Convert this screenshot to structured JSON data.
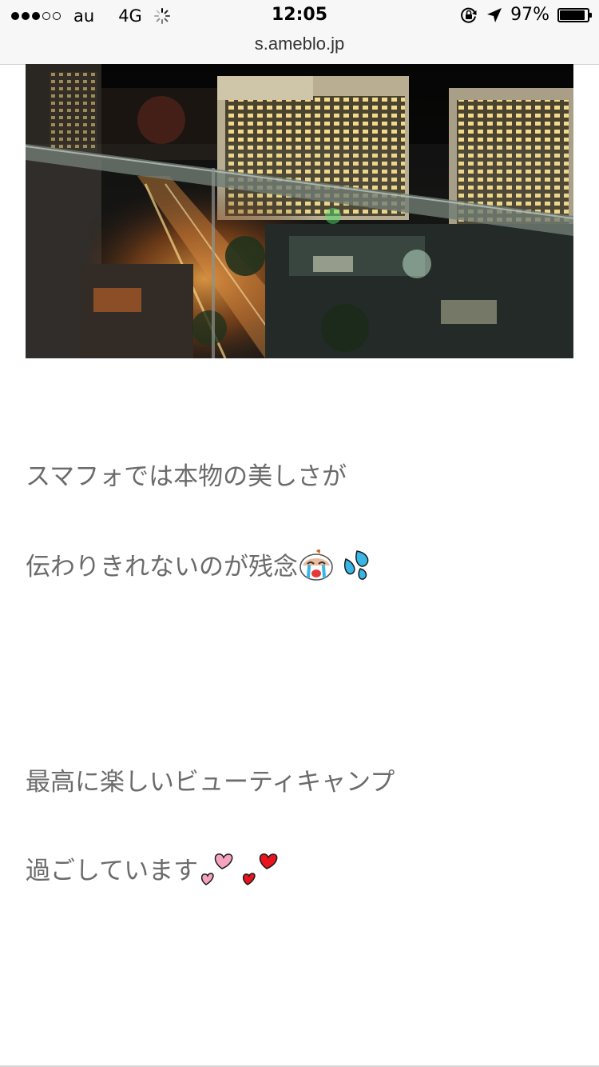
{
  "status_bar": {
    "signal_filled": 3,
    "signal_total": 5,
    "carrier": "au",
    "network": "4G",
    "time": "12:05",
    "battery_percent": "97%",
    "battery_level": 0.97
  },
  "address_bar": {
    "url": "s.ameblo.jp"
  },
  "post": {
    "photo_icon": "night-city-balcony-photo",
    "lines": [
      {
        "text": "スマフォでは本物の美しさが",
        "emojis": []
      },
      {
        "text": "伝わりきれないのが残念",
        "emojis": [
          "crying-face-icon",
          "sweat-drops-icon"
        ]
      },
      {
        "text": "最高に楽しいビューティキャンプ",
        "emojis": []
      },
      {
        "text": "過ごしています",
        "emojis": [
          "pink-hearts-icon",
          "red-hearts-icon"
        ]
      }
    ]
  },
  "colors": {
    "text": "#6b6b6b",
    "heart_pink": "#f6a3c0",
    "heart_red": "#e8141e",
    "drops": "#39b5e6"
  }
}
